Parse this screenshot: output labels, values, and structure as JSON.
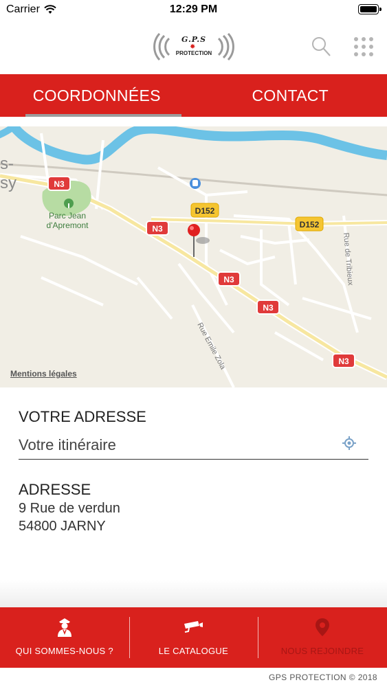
{
  "status_bar": {
    "carrier": "Carrier",
    "time": "12:29 PM"
  },
  "header": {
    "logo": {
      "line1": "G.P.S",
      "line2": "PROTECTION"
    },
    "search_icon": "search-icon",
    "menu_icon": "grid-icon"
  },
  "tabs": [
    {
      "label": "COORDONNÉES",
      "active": true
    },
    {
      "label": "CONTACT",
      "active": false
    }
  ],
  "map": {
    "place_fragment_1": "s-",
    "place_fragment_2": "sy",
    "park": {
      "line1": "Parc Jean",
      "line2": "d'Apremont"
    },
    "road_badges": [
      "N3",
      "N3",
      "N3",
      "N3",
      "N3",
      "D152",
      "D152"
    ],
    "street_1": "Rue Emile Zola",
    "street_2": "Rue de Tribieux",
    "mentions": "Mentions légales"
  },
  "route": {
    "title": "VOTRE ADRESSE",
    "placeholder": "Votre itinéraire"
  },
  "address": {
    "label": "ADRESSE",
    "line1": "9 Rue de verdun",
    "line2": "54800 JARNY"
  },
  "bottom_nav": [
    {
      "label": "QUI SOMMES-NOUS ?",
      "icon": "guard-icon"
    },
    {
      "label": "LE CATALOGUE",
      "icon": "camera-icon"
    },
    {
      "label": "NOUS REJOINDRE",
      "icon": "map-pin-icon"
    }
  ],
  "footer": {
    "copyright": "GPS PROTECTION © 2018"
  },
  "colors": {
    "brand_red": "#d9211d",
    "road_badge": "#e03a3a",
    "secondary_road": "#f5c531",
    "river": "#6cc2e6",
    "park": "#b7dca3"
  }
}
